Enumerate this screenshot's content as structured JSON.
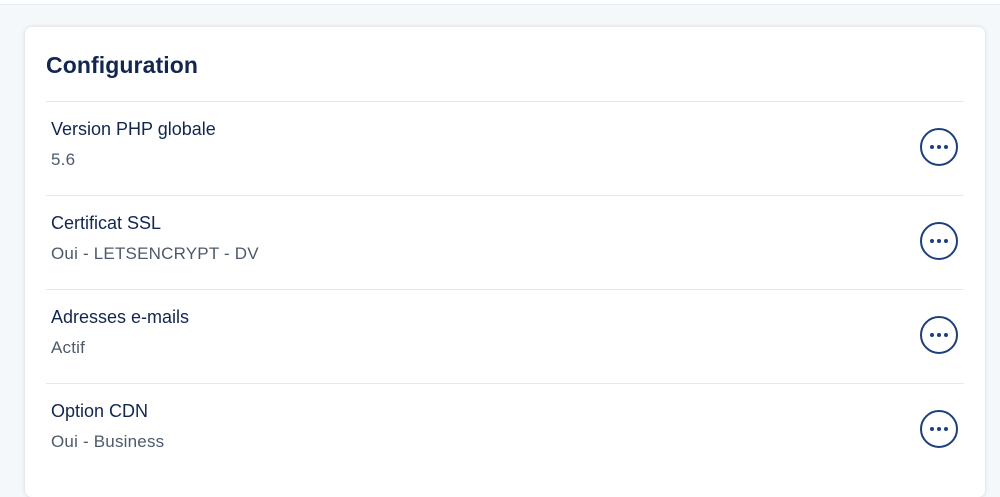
{
  "card": {
    "title": "Configuration",
    "items": [
      {
        "label": "Version PHP globale",
        "value": "5.6",
        "action_icon": "ellipsis-icon"
      },
      {
        "label": "Certificat SSL",
        "value": "Oui - LETSENCRYPT - DV",
        "action_icon": "ellipsis-icon"
      },
      {
        "label": "Adresses e-mails",
        "value": "Actif",
        "action_icon": "ellipsis-icon"
      },
      {
        "label": "Option CDN",
        "value": "Oui - Business",
        "action_icon": "ellipsis-icon"
      }
    ]
  },
  "colors": {
    "title": "#122650",
    "value_text": "#4d5a6b",
    "accent": "#1c3f7c",
    "divider": "#e4e9ee",
    "background": "#f4f8fb"
  }
}
